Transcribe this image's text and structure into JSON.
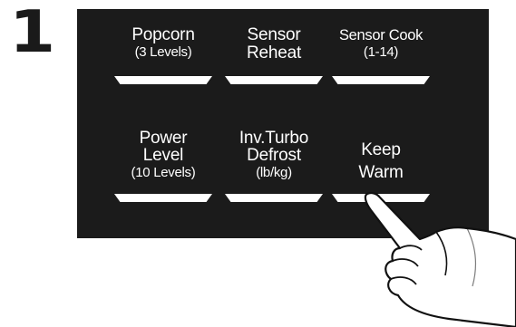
{
  "step": {
    "number": "1"
  },
  "panel": {
    "keys": [
      {
        "line1": "Popcorn",
        "line2": "(3 Levels)"
      },
      {
        "line1": "Sensor",
        "line2": "Reheat"
      },
      {
        "line1": "Sensor Cook",
        "line2": "(1-14)"
      },
      {
        "line1": "Power",
        "line2": "Level",
        "line3": "(10 Levels)"
      },
      {
        "line1": "Inv.Turbo",
        "line2": "Defrost",
        "line3": "(lb/kg)"
      },
      {
        "line1": "Keep",
        "line2": "Warm"
      }
    ]
  },
  "colors": {
    "panel_bg": "#1b1b1b",
    "key_text": "#ffffff",
    "background": "#ffffff"
  },
  "icons": {
    "hand": "pointing-hand-icon"
  }
}
